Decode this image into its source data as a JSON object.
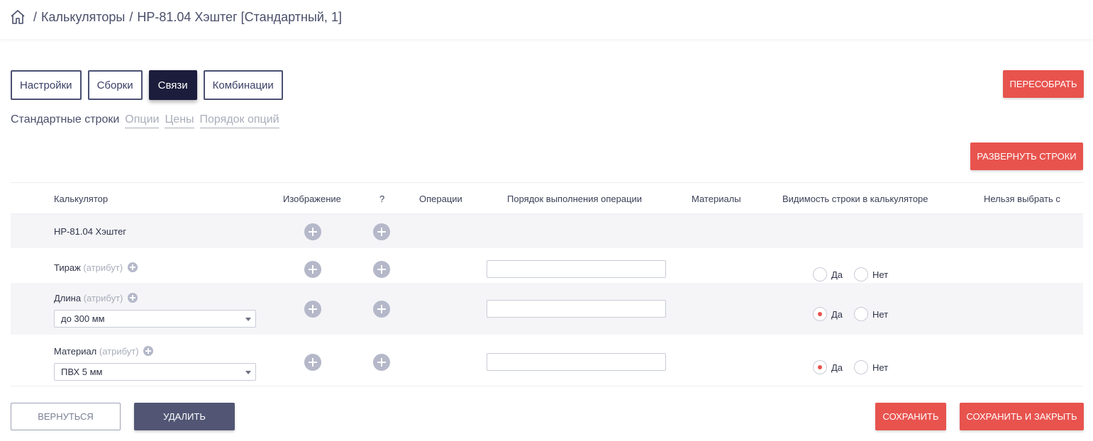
{
  "breadcrumb": {
    "home_icon": "home-icon",
    "separator": "/",
    "items": [
      "Калькуляторы",
      "HP-81.04 Хэштег [Стандартный, 1]"
    ]
  },
  "tabs": [
    {
      "label": "Настройки",
      "active": false
    },
    {
      "label": "Сборки",
      "active": false
    },
    {
      "label": "Связи",
      "active": true
    },
    {
      "label": "Комбинации",
      "active": false
    }
  ],
  "rebuild_button": "ПЕРЕСОБРАТЬ",
  "subtabs": [
    {
      "label": "Стандартные строки",
      "active": true
    },
    {
      "label": "Опции",
      "active": false
    },
    {
      "label": "Цены",
      "active": false
    },
    {
      "label": "Порядок опций",
      "active": false
    }
  ],
  "expand_button": "РАЗВЕРНУТЬ СТРОКИ",
  "table": {
    "headers": [
      "Калькулятор",
      "Изображение",
      "?",
      "Операции",
      "Порядок выполнения операции",
      "Материалы",
      "Видимость строки в калькуляторе",
      "Нельзя выбрать с"
    ],
    "calculator_row": {
      "name": "HP-81.04 Хэштег"
    },
    "rows": [
      {
        "name": "Тираж",
        "attr": "(атрибут)",
        "select": "",
        "order_value": "",
        "visibility": "",
        "yes": "Да",
        "no": "Нет"
      },
      {
        "name": "Длина",
        "attr": "(атрибут)",
        "select": "до 300 мм",
        "order_value": "",
        "visibility": "Да",
        "yes": "Да",
        "no": "Нет"
      },
      {
        "name": "Материал",
        "attr": "(атрибут)",
        "select": "ПВХ 5 мм",
        "order_value": "",
        "visibility": "Да",
        "yes": "Да",
        "no": "Нет"
      }
    ]
  },
  "footer": {
    "back": "ВЕРНУТЬСЯ",
    "delete": "УДАЛИТЬ",
    "save": "СОХРАНИТЬ",
    "save_close": "СОХРАНИТЬ И ЗАКРЫТЬ"
  },
  "colors": {
    "accent_red": "#e8534e",
    "dark_navy": "#1c1d3c",
    "slate": "#525674"
  }
}
